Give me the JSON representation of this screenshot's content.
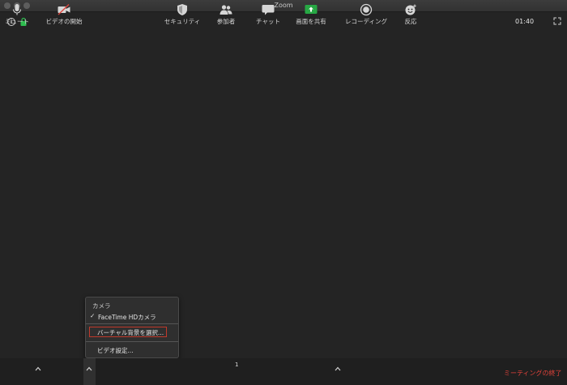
{
  "window": {
    "title": "Zoom"
  },
  "meeting": {
    "timer": "01:40"
  },
  "icons": {
    "info": "info-icon",
    "lock": "lock-icon",
    "fullscreen": "fullscreen-icon",
    "info_glyph": "i"
  },
  "colors": {
    "background": "#242424",
    "toolbar": "#1f1f1f",
    "lock_green": "#2ebd4f",
    "share_green": "#27a844",
    "end_red": "#e0423a",
    "highlight_red": "#c0392b"
  },
  "video_menu": {
    "section_label": "カメラ",
    "camera_option": "FaceTime HDカメラ",
    "check": "✓",
    "virtual_background": "バーチャル背景を選択...",
    "video_settings": "ビデオ設定..."
  },
  "toolbar": {
    "mute": "ミュート",
    "start_video": "ビデオの開始",
    "security": "セキュリティ",
    "participants": "参加者",
    "participants_count": "1",
    "chat": "チャット",
    "share_screen": "画面を共有",
    "recording": "レコーディング",
    "reactions": "反応",
    "end_meeting": "ミーティングの終了"
  }
}
